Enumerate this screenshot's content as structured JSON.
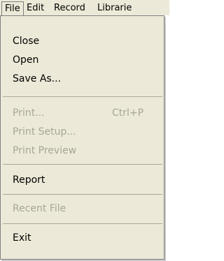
{
  "menubar": {
    "items": [
      "File",
      "Edit",
      "Record",
      "Librarie"
    ]
  },
  "file_menu": {
    "close": "Close",
    "open": "Open",
    "save_as": "Save As...",
    "print": "Print...",
    "print_shortcut": "Ctrl+P",
    "print_setup": "Print Setup...",
    "print_preview": "Print Preview",
    "report": "Report",
    "recent_file": "Recent File",
    "exit": "Exit"
  },
  "colors": {
    "menu_bg": "#ece9d8",
    "disabled_text": "#a7a697",
    "border": "#808080"
  }
}
